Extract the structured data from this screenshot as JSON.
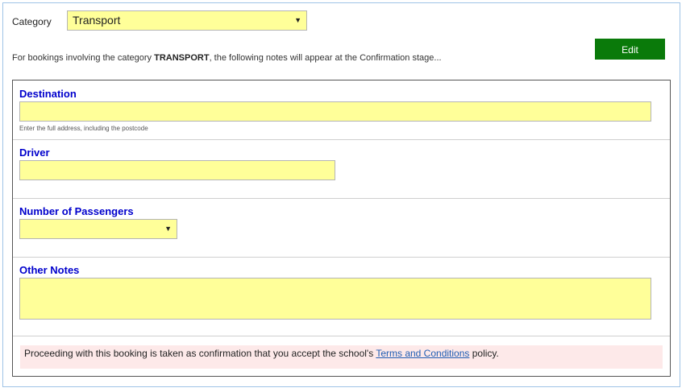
{
  "category": {
    "label": "Category",
    "selected": "Transport"
  },
  "notes_intro": {
    "prefix": "For bookings involving the category ",
    "category_name": "TRANSPORT",
    "suffix": ", the following notes will appear at the Confirmation stage..."
  },
  "edit_button": "Edit",
  "fields": {
    "destination": {
      "label": "Destination",
      "value": "",
      "hint": "Enter the full address, including the postcode"
    },
    "driver": {
      "label": "Driver",
      "value": ""
    },
    "passengers": {
      "label": "Number of Passengers",
      "selected": ""
    },
    "other_notes": {
      "label": "Other Notes",
      "value": ""
    }
  },
  "policy": {
    "prefix": "Proceeding with this booking is taken as confirmation that you accept the school's ",
    "link": "Terms and Conditions",
    "suffix": " policy."
  },
  "colors": {
    "input_bg": "#ffff99",
    "label_blue": "#0000cc",
    "edit_green": "#0a7a0a",
    "policy_bg": "#fde9e9",
    "link": "#1f5cb3"
  }
}
